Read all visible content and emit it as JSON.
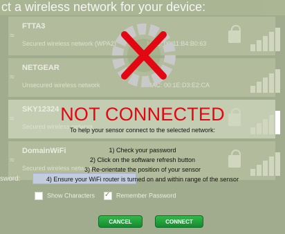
{
  "header": {
    "title": "ct a wireless network for your device:"
  },
  "networks": [
    {
      "name": "FTTA3",
      "security": "Secured wireless network (WPA2)",
      "mac": "MAC: 00:11:B4:B0:63"
    },
    {
      "name": "NETGEAR",
      "security": "Unsecured wireless network",
      "mac": "MAC: 00:1E:D3:E2:CA"
    },
    {
      "name": "SKY12324",
      "security": "Secured wireless network",
      "mac": ""
    },
    {
      "name": "DomainWiFi",
      "security": "Secured wireless network",
      "mac": ""
    }
  ],
  "status": {
    "title": "NOT CONNECTED",
    "subtitle": "To help your sensor connect to the selected network:",
    "steps": [
      "1) Check your password",
      "2) Click on the software refresh button",
      "3) Re-orientate the position of your sensor",
      "4) Ensure your WiFi router is turned on and within range of the sensor"
    ]
  },
  "form": {
    "password_label": "sword:",
    "show_characters": "Show Characters",
    "remember_password": "Remember Password"
  },
  "buttons": {
    "cancel": "CANCEL",
    "connect": "CONNECT"
  },
  "colors": {
    "error_red": "#e30613",
    "button_green": "#1f9a3a",
    "panel_olive": "#9aa77f"
  }
}
